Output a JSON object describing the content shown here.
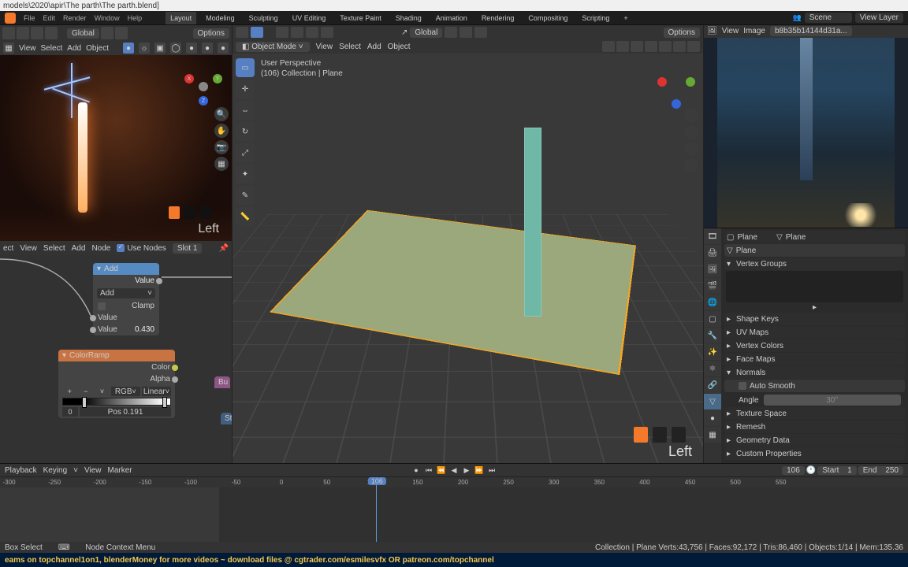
{
  "titlebar": "models\\2020\\apir\\The parth\\The parth.blend]",
  "menubar": {
    "file": "File",
    "edit": "Edit",
    "render": "Render",
    "window": "Window",
    "help": "Help"
  },
  "workspaces": [
    "Layout",
    "Modeling",
    "Sculpting",
    "UV Editing",
    "Texture Paint",
    "Shading",
    "Animation",
    "Rendering",
    "Compositing",
    "Scripting",
    "+"
  ],
  "scene_select": {
    "scene": "Scene",
    "viewlayer": "View Layer"
  },
  "preview": {
    "menus": {
      "view": "View",
      "select": "Select",
      "add": "Add",
      "object": "Object"
    },
    "orient": "Global",
    "options": "Options",
    "overlay_label": "Left"
  },
  "viewport": {
    "mode": "Object Mode",
    "menus": {
      "view": "View",
      "select": "Select",
      "add": "Add",
      "object": "Object"
    },
    "orient": "Global",
    "options": "Options",
    "info1": "User Perspective",
    "info2": "(106) Collection | Plane",
    "overlay_label": "Left"
  },
  "nodeeditor": {
    "menus": {
      "view": "View",
      "select": "Select",
      "add": "Add",
      "node": "Node",
      "use_nodes": "Use Nodes",
      "slot": "Slot 1"
    },
    "add_node": {
      "title": "Add",
      "value_lbl": "Value",
      "mode": "Add",
      "clamp": "Clamp",
      "input_lbl": "Value",
      "input_val": "0.430"
    },
    "ramp": {
      "title": "ColorRamp",
      "color": "Color",
      "alpha": "Alpha",
      "plus": "+",
      "minus": "−",
      "v": "˅",
      "mode": "RGB",
      "interp": "Linear",
      "idx": "0",
      "pos_lbl": "Pos",
      "pos_val": "0.191"
    },
    "bu": "Bu",
    "st": "St"
  },
  "image_editor": {
    "menus": {
      "view": "View",
      "image": "Image"
    },
    "image_name": "b8b35b14144d31a..."
  },
  "props": {
    "breadcrumb1": "Plane",
    "breadcrumb2": "Plane",
    "name": "Plane",
    "sections": {
      "vertex_groups": "Vertex Groups",
      "shape_keys": "Shape Keys",
      "uv_maps": "UV Maps",
      "vertex_colors": "Vertex Colors",
      "face_maps": "Face Maps",
      "normals": "Normals",
      "auto_smooth": "Auto Smooth",
      "angle_lbl": "Angle",
      "angle_val": "30°",
      "texture_space": "Texture Space",
      "remesh": "Remesh",
      "geometry_data": "Geometry Data",
      "custom_props": "Custom Properties"
    }
  },
  "timeline": {
    "menus": {
      "playback": "Playback",
      "keying": "Keying",
      "view": "View",
      "marker": "Marker"
    },
    "current": "106",
    "start_lbl": "Start",
    "start": "1",
    "end_lbl": "End",
    "end": "250",
    "ticks": [
      "-300",
      "-250",
      "-200",
      "-150",
      "-100",
      "-50",
      "0",
      "50",
      "100",
      "150",
      "200",
      "250",
      "300",
      "350",
      "400",
      "450",
      "500",
      "550"
    ]
  },
  "status": {
    "left": "Box Select",
    "ctx": "Node Context Menu",
    "right": "Collection | Plane  Verts:43,756 | Faces:92,172 | Tris:86,460 | Objects:1/14 | Mem:135.36"
  },
  "banner": "eams on topchannel1on1,  blenderMoney for more videos ~ download files @ cgtrader.com/esmilesvfx OR patreon.com/topchannel"
}
